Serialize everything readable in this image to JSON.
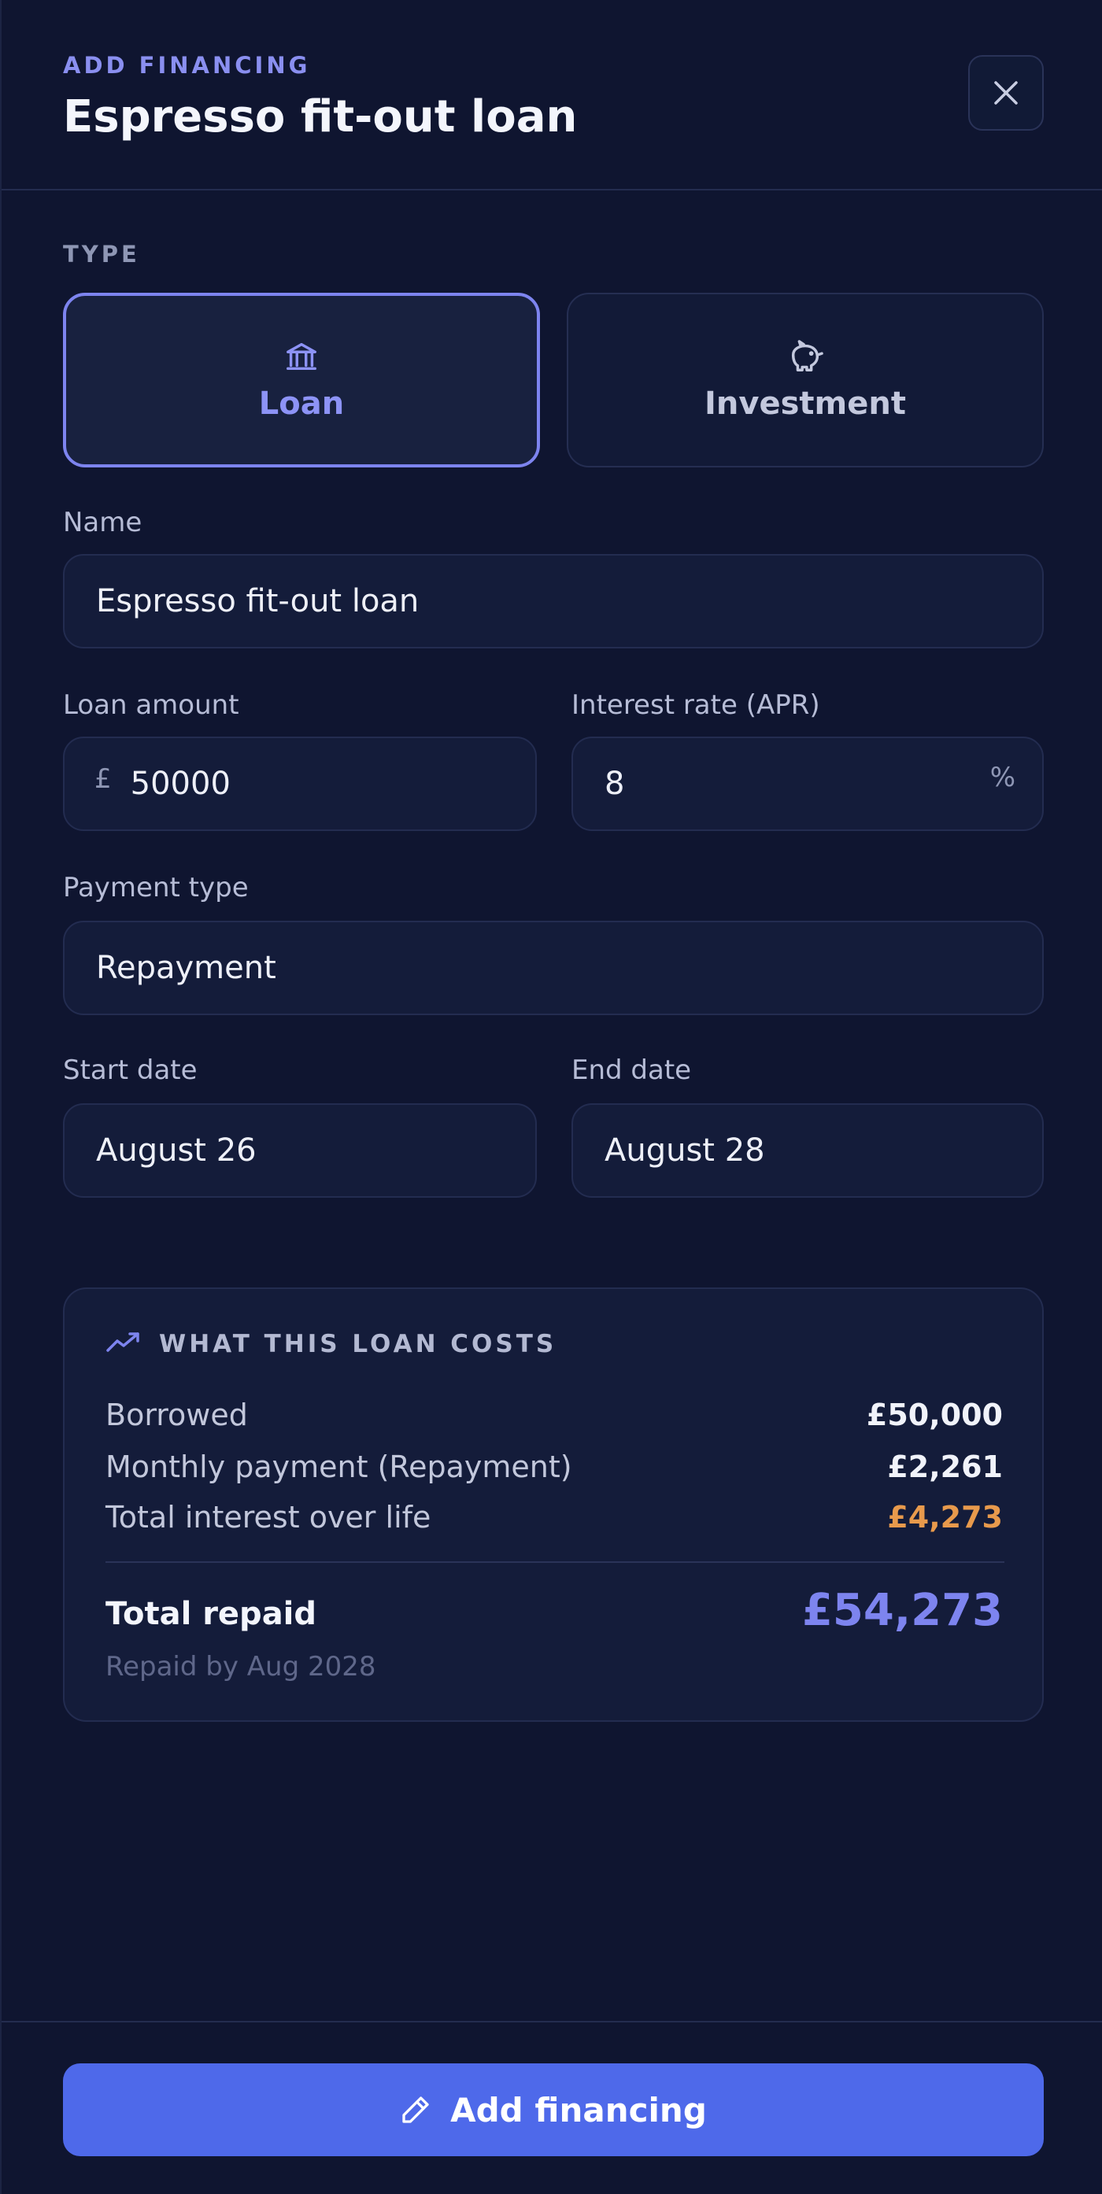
{
  "header": {
    "eyebrow": "ADD FINANCING",
    "title": "Espresso fit-out loan",
    "close_icon": "close-icon"
  },
  "type_section": {
    "label": "TYPE",
    "options": [
      {
        "label": "Loan",
        "icon": "bank-icon",
        "selected": true
      },
      {
        "label": "Investment",
        "icon": "piggy-bank-icon",
        "selected": false
      }
    ]
  },
  "form": {
    "name": {
      "label": "Name",
      "value": "Espresso fit-out loan"
    },
    "loan_amount": {
      "label": "Loan amount",
      "prefix": "£",
      "value": "50000"
    },
    "interest_rate": {
      "label": "Interest rate (APR)",
      "value": "8",
      "suffix": "%"
    },
    "payment_type": {
      "label": "Payment type",
      "value": "Repayment"
    },
    "start_date": {
      "label": "Start date",
      "value": "August 26"
    },
    "end_date": {
      "label": "End date",
      "value": "August 28"
    }
  },
  "costs": {
    "heading": "WHAT THIS LOAN COSTS",
    "icon": "trending-up-icon",
    "rows": [
      {
        "label": "Borrowed",
        "value": "£50,000"
      },
      {
        "label": "Monthly payment (Repayment)",
        "value": "£2,261"
      },
      {
        "label": "Total interest over life",
        "value": "£4,273"
      }
    ],
    "total_label": "Total repaid",
    "total_value": "£54,273",
    "repaid_by": "Repaid by Aug 2028"
  },
  "footer": {
    "submit_label": "Add financing",
    "submit_icon": "pencil-icon"
  },
  "colors": {
    "accent": "#7d84ef",
    "button": "#4e69ea",
    "interest": "#e89a4c",
    "background": "#0f1530"
  }
}
